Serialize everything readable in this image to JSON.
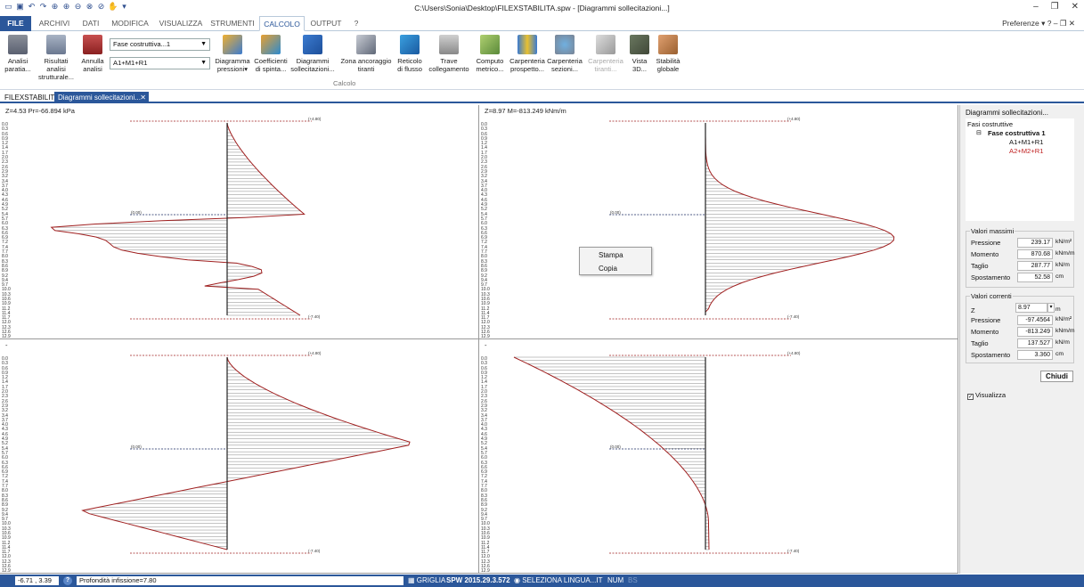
{
  "window": {
    "title": "C:\\Users\\Sonia\\Desktop\\FILEXSTABILITA.spw - [Diagrammi sollecitazioni...]",
    "preferences_label": "Preferenze"
  },
  "ribbon_tabs": [
    "FILE",
    "ARCHIVI",
    "DATI",
    "MODIFICA",
    "VISUALIZZA",
    "STRUMENTI",
    "CALCOLO",
    "OUTPUT",
    "?"
  ],
  "active_tab": "CALCOLO",
  "ribbon": {
    "combo_phase": "Fase costruttiva...1",
    "combo_combination": "A1+M1+R1",
    "group_label": "Calcolo",
    "buttons": [
      {
        "l1": "Analisi",
        "l2": "paratia..."
      },
      {
        "l1": "Risultati analisi",
        "l2": "strutturale..."
      },
      {
        "l1": "Annulla",
        "l2": "analisi"
      },
      {
        "l1": "Diagramma",
        "l2": "pressioni▾"
      },
      {
        "l1": "Coefficienti",
        "l2": "di spinta..."
      },
      {
        "l1": "Diagrammi",
        "l2": "sollecitazioni..."
      },
      {
        "l1": "Zona ancoraggio",
        "l2": "tiranti"
      },
      {
        "l1": "Reticolo",
        "l2": "di flusso"
      },
      {
        "l1": "Trave",
        "l2": "collegamento"
      },
      {
        "l1": "Computo",
        "l2": "metrico..."
      },
      {
        "l1": "Carpenteria",
        "l2": "prospetto..."
      },
      {
        "l1": "Carpenteria",
        "l2": "sezioni..."
      },
      {
        "l1": "Carpenteria",
        "l2": "tiranti..."
      },
      {
        "l1": "Vista",
        "l2": "3D..."
      },
      {
        "l1": "Stabilità",
        "l2": "globale"
      }
    ]
  },
  "doc_tabs": [
    "FILEXSTABILITA",
    "Diagrammi sollecitazioni..."
  ],
  "panels": {
    "p1_title": "Z=4.53 Pr=-66.894 kPa",
    "p2_title": "Z=8.97 M=-813.249 kNm/m",
    "p3_title": "-",
    "p4_title": "-",
    "top_level": "(+4.80)",
    "mid_level": "(0.00)",
    "bottom_level": "(-7.40)"
  },
  "depth_ticks": [
    "0.0",
    "0.3",
    "0.6",
    "0.9",
    "1.2",
    "1.4",
    "1.7",
    "2.0",
    "2.3",
    "2.6",
    "2.9",
    "3.2",
    "3.4",
    "3.7",
    "4.0",
    "4.3",
    "4.6",
    "4.9",
    "5.2",
    "5.4",
    "5.7",
    "6.0",
    "6.3",
    "6.6",
    "6.9",
    "7.2",
    "7.4",
    "7.7",
    "8.0",
    "8.3",
    "8.6",
    "8.9",
    "9.2",
    "9.4",
    "9.7",
    "10.0",
    "10.3",
    "10.6",
    "10.9",
    "11.2",
    "11.4",
    "11.7",
    "12.0",
    "12.3",
    "12.6",
    "12.9",
    "13.2",
    "13.4",
    "13.7"
  ],
  "context_menu": [
    "Stampa",
    "Copia"
  ],
  "side": {
    "title": "Diagrammi sollecitazioni...",
    "tree_root": "Fasi costruttive",
    "tree_phase": "Fase costruttiva 1",
    "tree_c1": "A1+M1+R1",
    "tree_c2": "A2+M2+R1",
    "max_label": "Valori massimi",
    "max_rows": [
      {
        "label": "Pressione",
        "value": "239.17",
        "unit": "kN/m²"
      },
      {
        "label": "Momento",
        "value": "870.68",
        "unit": "kNm/m"
      },
      {
        "label": "Taglio",
        "value": "287.77",
        "unit": "kN/m"
      },
      {
        "label": "Spostamento",
        "value": "52.58",
        "unit": "cm"
      }
    ],
    "cur_label": "Valori correnti",
    "z_label": "Z",
    "z_value": "8.97",
    "z_unit": "m",
    "cur_rows": [
      {
        "label": "Pressione",
        "value": "-97.4564",
        "unit": "kN/m²"
      },
      {
        "label": "Momento",
        "value": "-813.249",
        "unit": "kNm/m"
      },
      {
        "label": "Taglio",
        "value": "137.527",
        "unit": "kN/m"
      },
      {
        "label": "Spostamento",
        "value": "3.360",
        "unit": "cm"
      }
    ],
    "close_label": "Chiudi",
    "visualize_label": "Visualizza"
  },
  "status": {
    "coords": "-6.71 , 3.39",
    "message": "Profondità infissione=7.80",
    "grid": "GRIGLIA",
    "version": "SPW 2015.29.3.572",
    "language": "SELEZIONA LINGUA...IT",
    "num": "NUM",
    "bs": "BS"
  }
}
